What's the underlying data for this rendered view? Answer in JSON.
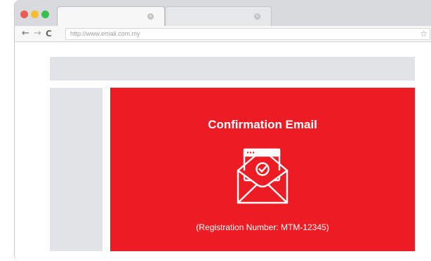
{
  "browser": {
    "controls": [
      "close",
      "minimize",
      "maximize"
    ],
    "tabs": [
      {
        "label": "",
        "active": true,
        "close_icon": "close-icon"
      },
      {
        "label": "",
        "active": false,
        "close_icon": "close-icon"
      }
    ],
    "tab_close_glyph": "×",
    "nav": {
      "back": "←",
      "forward": "→",
      "reload": "C"
    },
    "url": "http://www.email.com.my",
    "bookmark_glyph": "☆",
    "colors": {
      "close": "#ee5a52",
      "minimize": "#f5be34",
      "maximize": "#34c150"
    }
  },
  "card": {
    "title": "Confirmation Email",
    "subtitle": "(Registration Number: MTM-12345)",
    "icon": "envelope-check-icon",
    "color": "#ed1c24"
  }
}
